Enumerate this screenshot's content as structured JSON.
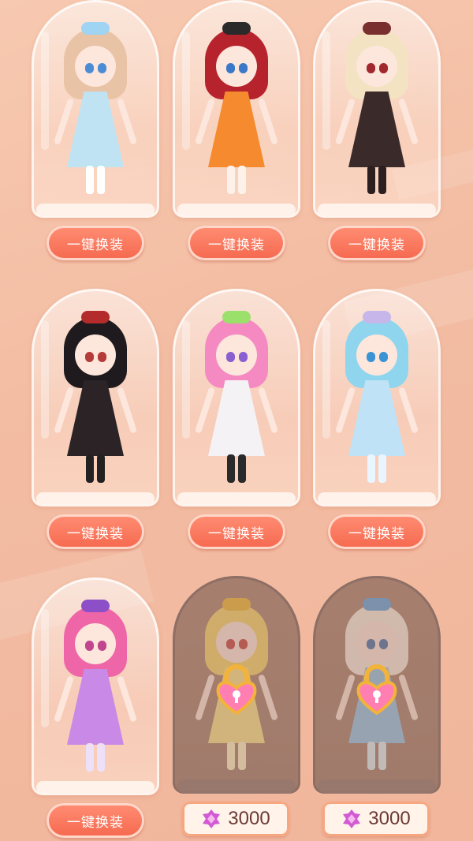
{
  "button_label": "一键换装",
  "price_value": "3000",
  "outfits": [
    {
      "id": 1,
      "locked": false,
      "colors": {
        "hair": "#e9c3a6",
        "dress": "#bfe3f3",
        "eye": "#4a8dd6",
        "acc": "#9fd4f2",
        "leg": "#ffffff"
      }
    },
    {
      "id": 2,
      "locked": false,
      "colors": {
        "hair": "#b7232d",
        "dress": "#f58a2e",
        "eye": "#3a78c9",
        "acc": "#2a2a2a",
        "leg": "#fdf2e9"
      }
    },
    {
      "id": 3,
      "locked": false,
      "colors": {
        "hair": "#f3e3c2",
        "dress": "#3b2a2a",
        "eye": "#a0282e",
        "acc": "#7a2f2f",
        "leg": "#2b1f1f"
      }
    },
    {
      "id": 4,
      "locked": false,
      "colors": {
        "hair": "#1e1a1e",
        "dress": "#2b2326",
        "eye": "#b53a3a",
        "acc": "#b32b2b",
        "leg": "#222222"
      }
    },
    {
      "id": 5,
      "locked": false,
      "colors": {
        "hair": "#f58ac2",
        "dress": "#f5f2f5",
        "eye": "#8a5fd0",
        "acc": "#9ae06a",
        "leg": "#2a2a2a"
      }
    },
    {
      "id": 6,
      "locked": false,
      "colors": {
        "hair": "#8fd5ee",
        "dress": "#bfe2f7",
        "eye": "#3a93d4",
        "acc": "#c7b6ea",
        "leg": "#eaf6ff"
      }
    },
    {
      "id": 7,
      "locked": false,
      "colors": {
        "hair": "#ef66a8",
        "dress": "#c98ae7",
        "eye": "#c2468e",
        "acc": "#8c4fc7",
        "leg": "#eee0f8"
      }
    },
    {
      "id": 8,
      "locked": true,
      "colors": {
        "hair": "#f4d46a",
        "dress": "#f8e28a",
        "eye": "#c24040",
        "acc": "#e9b530",
        "leg": "#fff3c4"
      }
    },
    {
      "id": 9,
      "locked": true,
      "colors": {
        "hair": "#f4ece0",
        "dress": "#8fc4ea",
        "eye": "#3e6fa8",
        "acc": "#5aa0e0",
        "leg": "#dbeefa"
      }
    }
  ]
}
